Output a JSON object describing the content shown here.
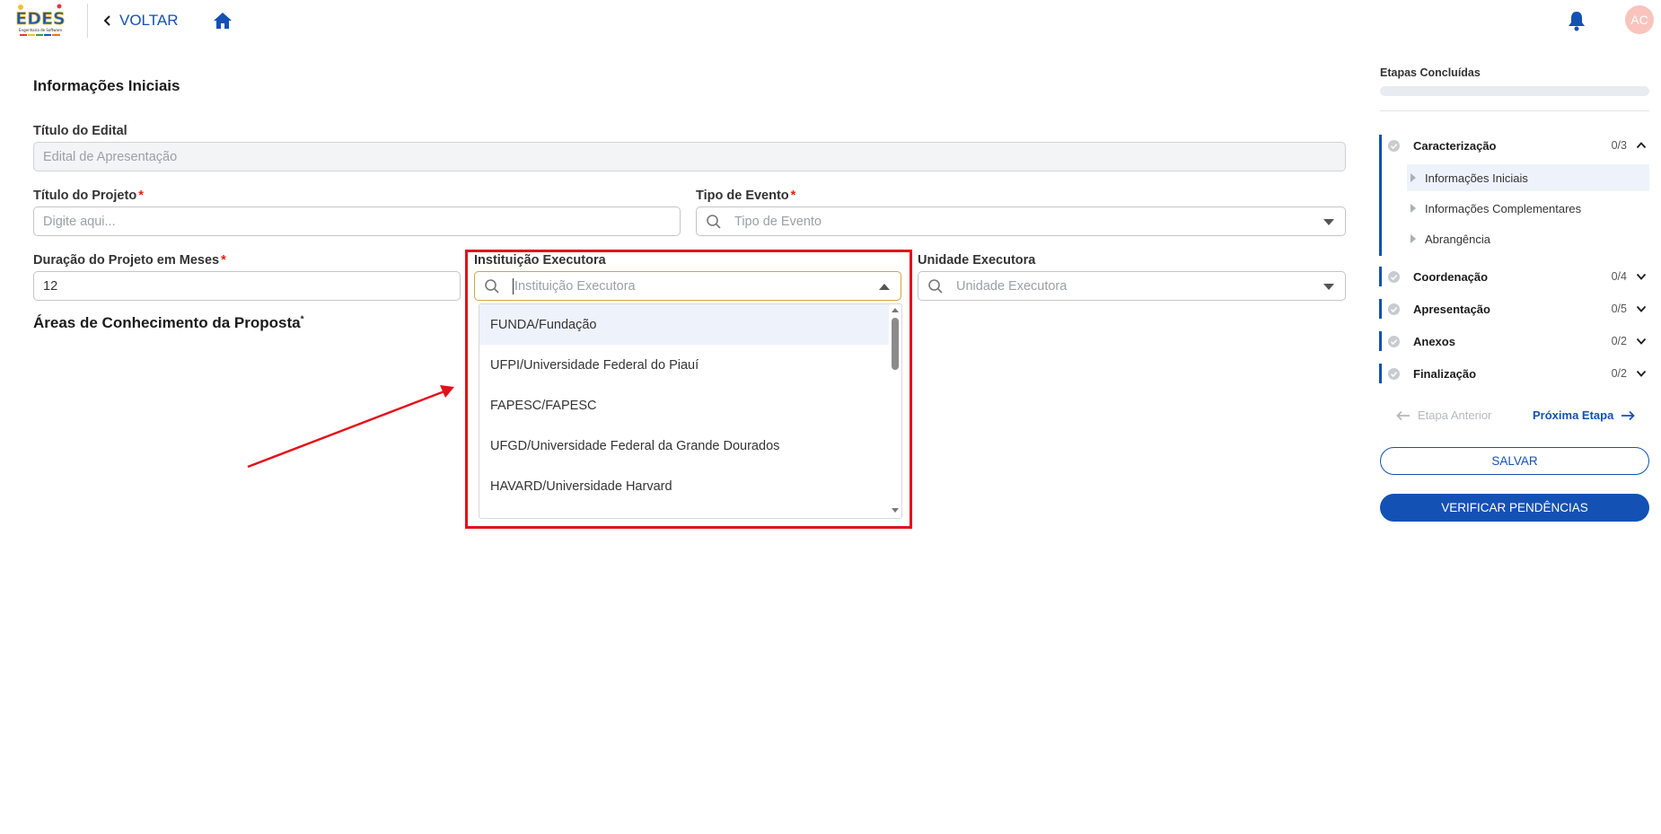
{
  "header": {
    "logo_text": "EDES",
    "logo_subtext": "Engenharia de Software",
    "back_label": "VOLTAR",
    "avatar_initials": "AC",
    "icons": [
      "chevron-left-icon",
      "home-icon",
      "bell-icon"
    ]
  },
  "form": {
    "section_title": "Informações Iniciais",
    "titulo_edital": {
      "label": "Título do Edital",
      "placeholder": "Edital de Apresentação"
    },
    "titulo_projeto": {
      "label": "Título do Projeto",
      "required": "*",
      "placeholder": "Digite aqui..."
    },
    "tipo_evento": {
      "label": "Tipo de Evento",
      "required": "*",
      "placeholder": "Tipo de Evento"
    },
    "duracao": {
      "label": "Duração do Projeto em Meses",
      "required": "*",
      "value": "12"
    },
    "instituicao": {
      "label": "Instituição Executora",
      "placeholder": "Instituição Executora",
      "options": [
        "FUNDA/Fundação",
        "UFPI/Universidade Federal do Piauí",
        "FAPESC/FAPESC",
        "UFGD/Universidade Federal da Grande Dourados",
        "HAVARD/Universidade Harvard"
      ]
    },
    "unidade": {
      "label": "Unidade Executora",
      "placeholder": "Unidade Executora"
    },
    "areas_title": "Áreas de Conhecimento da Proposta",
    "areas_required": "*"
  },
  "sidebar": {
    "title": "Etapas Concluídas",
    "progress": 0,
    "steps": [
      {
        "name": "Caracterização",
        "count": "0/3",
        "expanded": true,
        "subs": [
          "Informações Iniciais",
          "Informações Complementares",
          "Abrangência"
        ]
      },
      {
        "name": "Coordenação",
        "count": "0/4"
      },
      {
        "name": "Apresentação",
        "count": "0/5"
      },
      {
        "name": "Anexos",
        "count": "0/2"
      },
      {
        "name": "Finalização",
        "count": "0/2"
      }
    ],
    "prev_label": "Etapa Anterior",
    "next_label": "Próxima Etapa",
    "save_label": "SALVAR",
    "verify_label": "VERIFICAR PENDÊNCIAS"
  },
  "colors": {
    "primary": "#1351b4",
    "required": "#e52207",
    "annotation": "#e3101a",
    "focus_border": "#d9a33b"
  }
}
